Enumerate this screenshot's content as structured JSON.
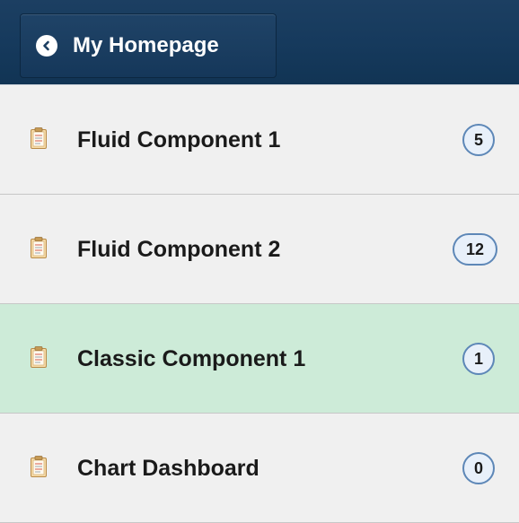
{
  "header": {
    "back_label": "My Homepage"
  },
  "items": [
    {
      "label": "Fluid Component 1",
      "count": "5",
      "selected": false,
      "icon": "clipboard-icon"
    },
    {
      "label": "Fluid Component 2",
      "count": "12",
      "selected": false,
      "icon": "clipboard-icon"
    },
    {
      "label": "Classic Component 1",
      "count": "1",
      "selected": true,
      "icon": "clipboard-icon"
    },
    {
      "label": "Chart Dashboard",
      "count": "0",
      "selected": false,
      "icon": "clipboard-icon"
    }
  ],
  "colors": {
    "header_bg": "#163a5d",
    "selected_bg": "#cdebd8",
    "badge_border": "#5d87b7",
    "badge_bg": "#e8f0fa"
  }
}
